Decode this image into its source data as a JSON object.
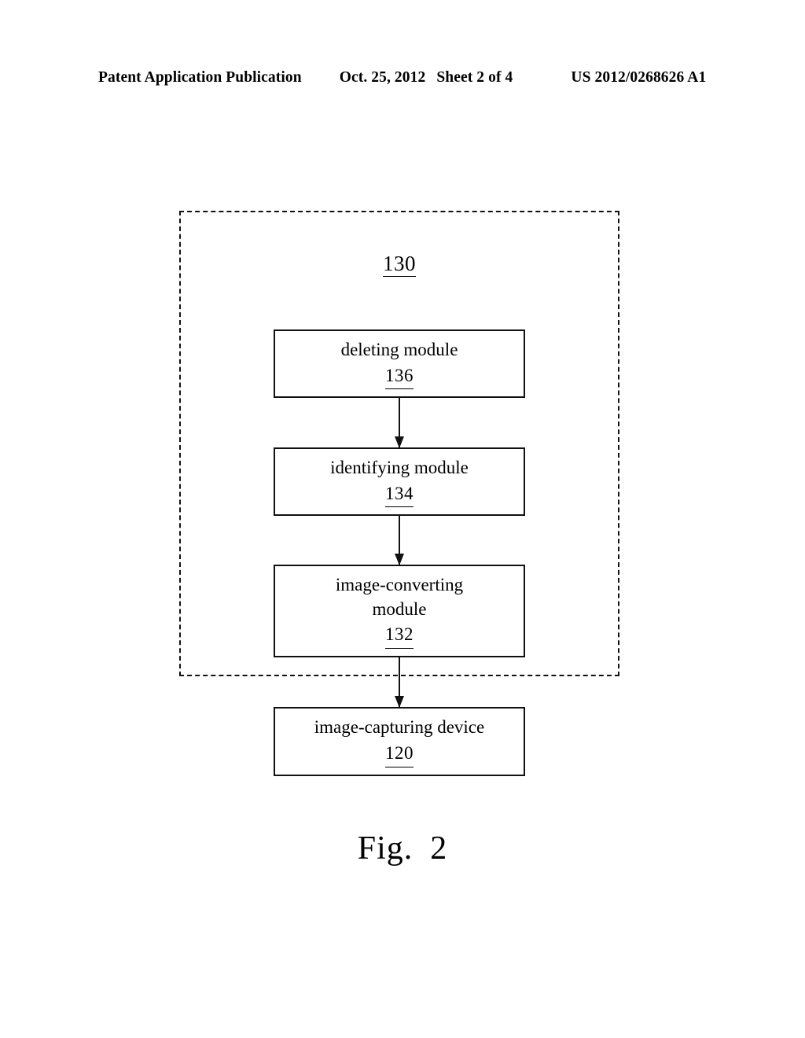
{
  "header": {
    "publication": "Patent Application Publication",
    "date": "Oct. 25, 2012",
    "sheet": "Sheet 2 of 4",
    "patent_number": "US 2012/0268626 A1"
  },
  "figure": {
    "caption_word": "Fig.",
    "caption_number": "2",
    "system": {
      "ref": "130",
      "border_style": "dashed"
    },
    "boxes": [
      {
        "title": "deleting module",
        "ref": "136"
      },
      {
        "title": "identifying module",
        "ref": "134"
      },
      {
        "title": "image-converting\nmodule",
        "ref": "132"
      },
      {
        "title": "image-capturing device",
        "ref": "120"
      }
    ],
    "connectors": [
      {
        "from": "136",
        "to": "134",
        "head": "arrow-down"
      },
      {
        "from": "134",
        "to": "132",
        "head": "arrow-down"
      },
      {
        "from": "132",
        "to": "120",
        "head": "arrow-down"
      }
    ]
  },
  "colors": {
    "ink": "#111111",
    "background": "#ffffff"
  }
}
